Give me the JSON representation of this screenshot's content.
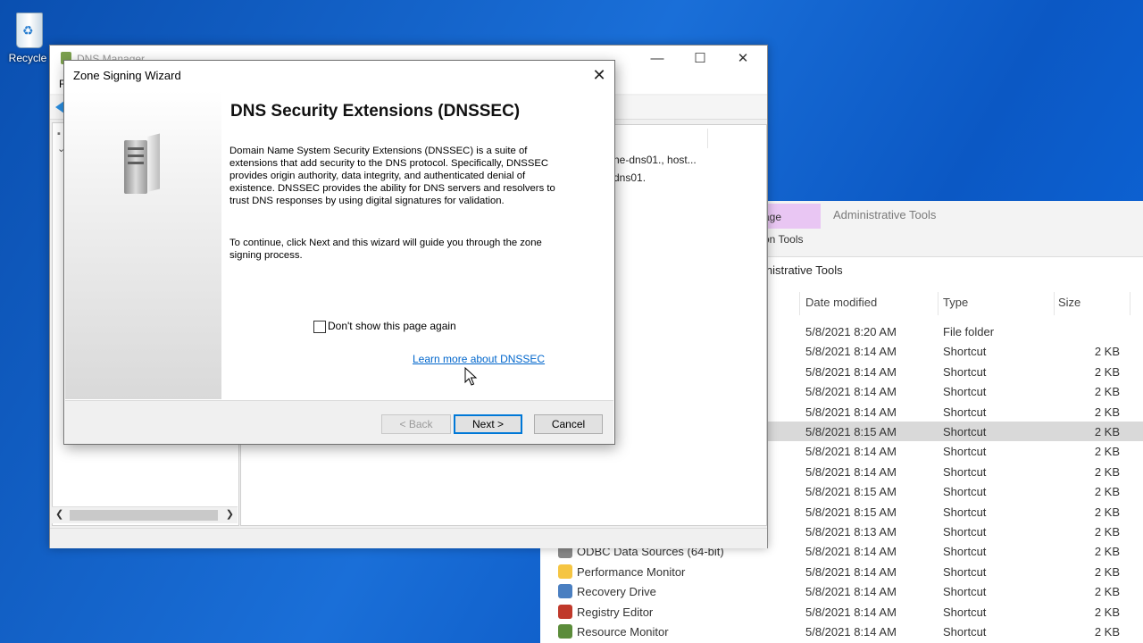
{
  "desktop": {
    "recycle_label": "Recycle"
  },
  "dns_manager": {
    "title": "DNS Manager",
    "menu_first": "F",
    "window_controls": {
      "minimize": "—",
      "maximize": "☐",
      "close": "✕"
    },
    "detail_line1": "ne-dns01., host...",
    "detail_line2": "dns01."
  },
  "explorer": {
    "tab_manage": "age",
    "tab_app_tools": "on Tools",
    "title": "Administrative Tools",
    "address": "inistrative Tools",
    "columns": {
      "date": "Date modified",
      "type": "Type",
      "size": "Size"
    },
    "rows": [
      {
        "name": "",
        "date": "5/8/2021 8:20 AM",
        "type": "File folder",
        "size": ""
      },
      {
        "name": "",
        "date": "5/8/2021 8:14 AM",
        "type": "Shortcut",
        "size": "2 KB"
      },
      {
        "name": "",
        "date": "5/8/2021 8:14 AM",
        "type": "Shortcut",
        "size": "2 KB"
      },
      {
        "name": "",
        "date": "5/8/2021 8:14 AM",
        "type": "Shortcut",
        "size": "2 KB"
      },
      {
        "name": "",
        "date": "5/8/2021 8:14 AM",
        "type": "Shortcut",
        "size": "2 KB"
      },
      {
        "name": "",
        "date": "5/8/2021 8:15 AM",
        "type": "Shortcut",
        "size": "2 KB"
      },
      {
        "name": "",
        "date": "5/8/2021 8:14 AM",
        "type": "Shortcut",
        "size": "2 KB"
      },
      {
        "name": "",
        "date": "5/8/2021 8:14 AM",
        "type": "Shortcut",
        "size": "2 KB"
      },
      {
        "name": "",
        "date": "5/8/2021 8:15 AM",
        "type": "Shortcut",
        "size": "2 KB"
      },
      {
        "name": "",
        "date": "5/8/2021 8:15 AM",
        "type": "Shortcut",
        "size": "2 KB"
      },
      {
        "name": "",
        "date": "5/8/2021 8:13 AM",
        "type": "Shortcut",
        "size": "2 KB"
      },
      {
        "name": "ODBC Data Sources (64-bit)",
        "date": "5/8/2021 8:14 AM",
        "type": "Shortcut",
        "size": "2 KB"
      },
      {
        "name": "Performance Monitor",
        "date": "5/8/2021 8:14 AM",
        "type": "Shortcut",
        "size": "2 KB"
      },
      {
        "name": "Recovery Drive",
        "date": "5/8/2021 8:14 AM",
        "type": "Shortcut",
        "size": "2 KB"
      },
      {
        "name": "Registry Editor",
        "date": "5/8/2021 8:14 AM",
        "type": "Shortcut",
        "size": "2 KB"
      },
      {
        "name": "Resource Monitor",
        "date": "5/8/2021 8:14 AM",
        "type": "Shortcut",
        "size": "2 KB"
      }
    ],
    "selected_row_index": 5
  },
  "wizard": {
    "title": "Zone Signing Wizard",
    "close_glyph": "✕",
    "heading": "DNS Security Extensions (DNSSEC)",
    "paragraph1": "Domain Name System Security Extensions (DNSSEC) is a suite of extensions that add security to the DNS protocol. Specifically, DNSSEC provides origin authority, data integrity, and authenticated denial of existence. DNSSEC provides the ability for DNS servers and resolvers to trust DNS responses by using digital signatures for validation.",
    "paragraph2": "To continue, click Next and this wizard will guide you through the zone signing process.",
    "checkbox_label": "Don't show this page again",
    "checkbox_checked": false,
    "link_text": "Learn more about DNSSEC",
    "buttons": {
      "back": "< Back",
      "next": "Next >",
      "cancel": "Cancel"
    }
  }
}
